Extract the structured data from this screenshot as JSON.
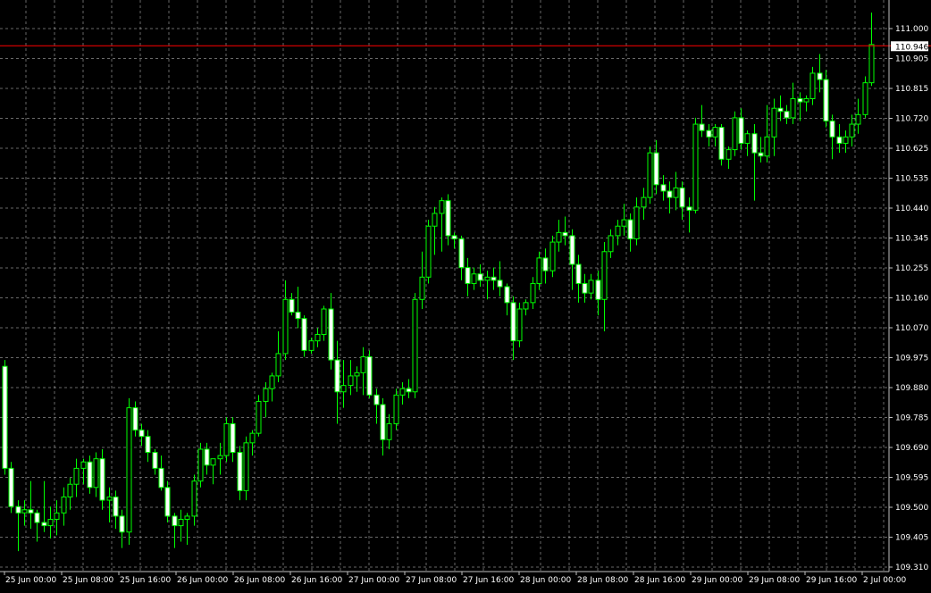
{
  "colors": {
    "background": "#000000",
    "grid": "#c0c0c0",
    "candle_bull_body": "#000000",
    "candle_bear_body": "#ffffff",
    "candle_wick": "#00ff00",
    "axis_text": "#ffffff",
    "price_line": "#ff0000",
    "price_label_bg": "#ffffff",
    "price_label_text": "#000000"
  },
  "chart_data": {
    "type": "candlestick",
    "grid": true,
    "ylim": [
      109.27,
      111.06
    ],
    "y_ticks": [
      "111.000",
      "110.905",
      "110.815",
      "110.720",
      "110.625",
      "110.535",
      "110.440",
      "110.345",
      "110.255",
      "110.160",
      "110.070",
      "109.975",
      "109.880",
      "109.785",
      "109.690",
      "109.595",
      "109.500",
      "109.405",
      "109.310"
    ],
    "x_ticks": [
      "25 Jun 00:00",
      "25 Jun 08:00",
      "25 Jun 16:00",
      "26 Jun 00:00",
      "26 Jun 08:00",
      "26 Jun 16:00",
      "27 Jun 00:00",
      "27 Jun 08:00",
      "27 Jun 16:00",
      "28 Jun 00:00",
      "28 Jun 08:00",
      "28 Jun 16:00",
      "29 Jun 00:00",
      "29 Jun 08:00",
      "29 Jun 16:00",
      "2 Jul 00:00"
    ],
    "current_price": "110.946",
    "current_price_value": 110.946,
    "candles": [
      [
        109.94,
        109.96,
        109.6,
        109.62
      ],
      [
        109.62,
        109.64,
        109.48,
        109.5
      ],
      [
        109.5,
        109.52,
        109.36,
        109.48
      ],
      [
        109.48,
        109.52,
        109.44,
        109.49
      ],
      [
        109.49,
        109.58,
        109.43,
        109.48
      ],
      [
        109.48,
        109.49,
        109.39,
        109.45
      ],
      [
        109.45,
        109.58,
        109.42,
        109.44
      ],
      [
        109.44,
        109.5,
        109.4,
        109.46
      ],
      [
        109.46,
        109.52,
        109.41,
        109.48
      ],
      [
        109.48,
        109.56,
        109.44,
        109.53
      ],
      [
        109.53,
        109.59,
        109.49,
        109.57
      ],
      [
        109.57,
        109.65,
        109.53,
        109.62
      ],
      [
        109.62,
        109.65,
        109.57,
        109.64
      ],
      [
        109.64,
        109.66,
        109.54,
        109.56
      ],
      [
        109.56,
        109.67,
        109.53,
        109.65
      ],
      [
        109.65,
        109.68,
        109.49,
        109.52
      ],
      [
        109.52,
        109.56,
        109.45,
        109.53
      ],
      [
        109.53,
        109.55,
        109.43,
        109.47
      ],
      [
        109.47,
        109.49,
        109.37,
        109.42
      ],
      [
        109.42,
        109.84,
        109.38,
        109.81
      ],
      [
        109.81,
        109.83,
        109.72,
        109.74
      ],
      [
        109.74,
        109.76,
        109.69,
        109.72
      ],
      [
        109.72,
        109.74,
        109.64,
        109.67
      ],
      [
        109.67,
        109.68,
        109.6,
        109.62
      ],
      [
        109.62,
        109.66,
        109.55,
        109.56
      ],
      [
        109.56,
        109.58,
        109.45,
        109.47
      ],
      [
        109.47,
        109.48,
        109.37,
        109.44
      ],
      [
        109.44,
        109.49,
        109.39,
        109.46
      ],
      [
        109.46,
        109.48,
        109.38,
        109.47
      ],
      [
        109.47,
        109.6,
        109.44,
        109.58
      ],
      [
        109.58,
        109.7,
        109.56,
        109.68
      ],
      [
        109.68,
        109.7,
        109.6,
        109.63
      ],
      [
        109.63,
        109.65,
        109.57,
        109.65
      ],
      [
        109.65,
        109.7,
        109.6,
        109.66
      ],
      [
        109.66,
        109.78,
        109.64,
        109.76
      ],
      [
        109.76,
        109.78,
        109.64,
        109.67
      ],
      [
        109.67,
        109.69,
        109.52,
        109.55
      ],
      [
        109.55,
        109.72,
        109.52,
        109.7
      ],
      [
        109.7,
        109.74,
        109.66,
        109.73
      ],
      [
        109.73,
        109.85,
        109.72,
        109.83
      ],
      [
        109.83,
        109.89,
        109.78,
        109.87
      ],
      [
        109.87,
        109.92,
        109.83,
        109.91
      ],
      [
        109.91,
        110.05,
        109.89,
        109.98
      ],
      [
        109.98,
        110.21,
        109.96,
        110.15
      ],
      [
        110.15,
        110.17,
        110.1,
        110.11
      ],
      [
        110.11,
        110.19,
        110.06,
        110.09
      ],
      [
        110.09,
        110.1,
        109.97,
        109.99
      ],
      [
        109.99,
        110.03,
        109.98,
        110.02
      ],
      [
        110.02,
        110.06,
        110.0,
        110.04
      ],
      [
        110.04,
        110.13,
        110.02,
        110.12
      ],
      [
        110.12,
        110.17,
        109.93,
        109.96
      ],
      [
        109.96,
        110.02,
        109.76,
        109.86
      ],
      [
        109.86,
        109.96,
        109.81,
        109.88
      ],
      [
        109.88,
        109.96,
        109.85,
        109.91
      ],
      [
        109.91,
        109.94,
        109.86,
        109.92
      ],
      [
        109.92,
        110.0,
        109.85,
        109.97
      ],
      [
        109.97,
        109.99,
        109.84,
        109.85
      ],
      [
        109.85,
        109.87,
        109.76,
        109.82
      ],
      [
        109.82,
        109.84,
        109.66,
        109.71
      ],
      [
        109.71,
        109.79,
        109.68,
        109.76
      ],
      [
        109.76,
        109.87,
        109.74,
        109.85
      ],
      [
        109.85,
        109.89,
        109.82,
        109.87
      ],
      [
        109.87,
        109.9,
        109.84,
        109.86
      ],
      [
        109.86,
        110.17,
        109.84,
        110.15
      ],
      [
        110.15,
        110.3,
        110.12,
        110.22
      ],
      [
        110.22,
        110.4,
        110.2,
        110.38
      ],
      [
        110.38,
        110.44,
        110.29,
        110.42
      ],
      [
        110.42,
        110.47,
        110.3,
        110.46
      ],
      [
        110.46,
        110.48,
        110.32,
        110.35
      ],
      [
        110.35,
        110.36,
        110.31,
        110.34
      ],
      [
        110.34,
        110.35,
        110.21,
        110.25
      ],
      [
        110.25,
        110.28,
        110.16,
        110.2
      ],
      [
        110.2,
        110.25,
        110.18,
        110.23
      ],
      [
        110.23,
        110.26,
        110.19,
        110.21
      ],
      [
        110.21,
        110.24,
        110.15,
        110.22
      ],
      [
        110.22,
        110.25,
        110.18,
        110.21
      ],
      [
        110.21,
        110.27,
        110.16,
        110.19
      ],
      [
        110.19,
        110.2,
        110.1,
        110.14
      ],
      [
        110.14,
        110.16,
        109.96,
        110.02
      ],
      [
        110.02,
        110.14,
        110.0,
        110.12
      ],
      [
        110.12,
        110.15,
        110.1,
        110.14
      ],
      [
        110.14,
        110.22,
        110.12,
        110.2
      ],
      [
        110.2,
        110.3,
        110.18,
        110.28
      ],
      [
        110.28,
        110.31,
        110.2,
        110.24
      ],
      [
        110.24,
        110.35,
        110.22,
        110.33
      ],
      [
        110.33,
        110.4,
        110.3,
        110.36
      ],
      [
        110.36,
        110.41,
        110.32,
        110.35
      ],
      [
        110.35,
        110.37,
        110.18,
        110.26
      ],
      [
        110.26,
        110.29,
        110.14,
        110.2
      ],
      [
        110.2,
        110.23,
        110.14,
        110.17
      ],
      [
        110.17,
        110.23,
        110.15,
        110.21
      ],
      [
        110.21,
        110.24,
        110.1,
        110.15
      ],
      [
        110.15,
        110.33,
        110.05,
        110.3
      ],
      [
        110.3,
        110.37,
        110.28,
        110.35
      ],
      [
        110.35,
        110.4,
        110.32,
        110.38
      ],
      [
        110.38,
        110.45,
        110.35,
        110.4
      ],
      [
        110.4,
        110.42,
        110.3,
        110.34
      ],
      [
        110.34,
        110.47,
        110.32,
        110.44
      ],
      [
        110.44,
        110.5,
        110.4,
        110.47
      ],
      [
        110.47,
        110.63,
        110.45,
        110.61
      ],
      [
        110.61,
        110.65,
        110.48,
        110.51
      ],
      [
        110.51,
        110.54,
        110.46,
        110.49
      ],
      [
        110.49,
        110.52,
        110.42,
        110.47
      ],
      [
        110.47,
        110.55,
        110.43,
        110.5
      ],
      [
        110.5,
        110.52,
        110.4,
        110.44
      ],
      [
        110.44,
        110.47,
        110.36,
        110.43
      ],
      [
        110.43,
        110.72,
        110.42,
        110.7
      ],
      [
        110.7,
        110.76,
        110.66,
        110.68
      ],
      [
        110.68,
        110.7,
        110.63,
        110.66
      ],
      [
        110.66,
        110.7,
        110.63,
        110.69
      ],
      [
        110.69,
        110.7,
        110.57,
        110.59
      ],
      [
        110.59,
        110.63,
        110.56,
        110.62
      ],
      [
        110.62,
        110.74,
        110.6,
        110.72
      ],
      [
        110.72,
        110.75,
        110.62,
        110.64
      ],
      [
        110.64,
        110.68,
        110.6,
        110.67
      ],
      [
        110.67,
        110.7,
        110.46,
        110.61
      ],
      [
        110.61,
        110.66,
        110.58,
        110.6
      ],
      [
        110.6,
        110.76,
        110.58,
        110.66
      ],
      [
        110.66,
        110.78,
        110.6,
        110.75
      ],
      [
        110.75,
        110.79,
        110.71,
        110.74
      ],
      [
        110.74,
        110.76,
        110.7,
        110.72
      ],
      [
        110.72,
        110.83,
        110.7,
        110.78
      ],
      [
        110.78,
        110.8,
        110.71,
        110.77
      ],
      [
        110.77,
        110.79,
        110.74,
        110.78
      ],
      [
        110.78,
        110.88,
        110.76,
        110.86
      ],
      [
        110.86,
        110.92,
        110.8,
        110.84
      ],
      [
        110.84,
        110.87,
        110.69,
        110.71
      ],
      [
        110.71,
        110.73,
        110.59,
        110.66
      ],
      [
        110.66,
        110.7,
        110.61,
        110.64
      ],
      [
        110.64,
        110.68,
        110.61,
        110.66
      ],
      [
        110.66,
        110.73,
        110.63,
        110.7
      ],
      [
        110.7,
        110.78,
        110.67,
        110.73
      ],
      [
        110.73,
        110.85,
        110.72,
        110.83
      ],
      [
        110.83,
        111.05,
        110.82,
        110.95
      ]
    ]
  }
}
